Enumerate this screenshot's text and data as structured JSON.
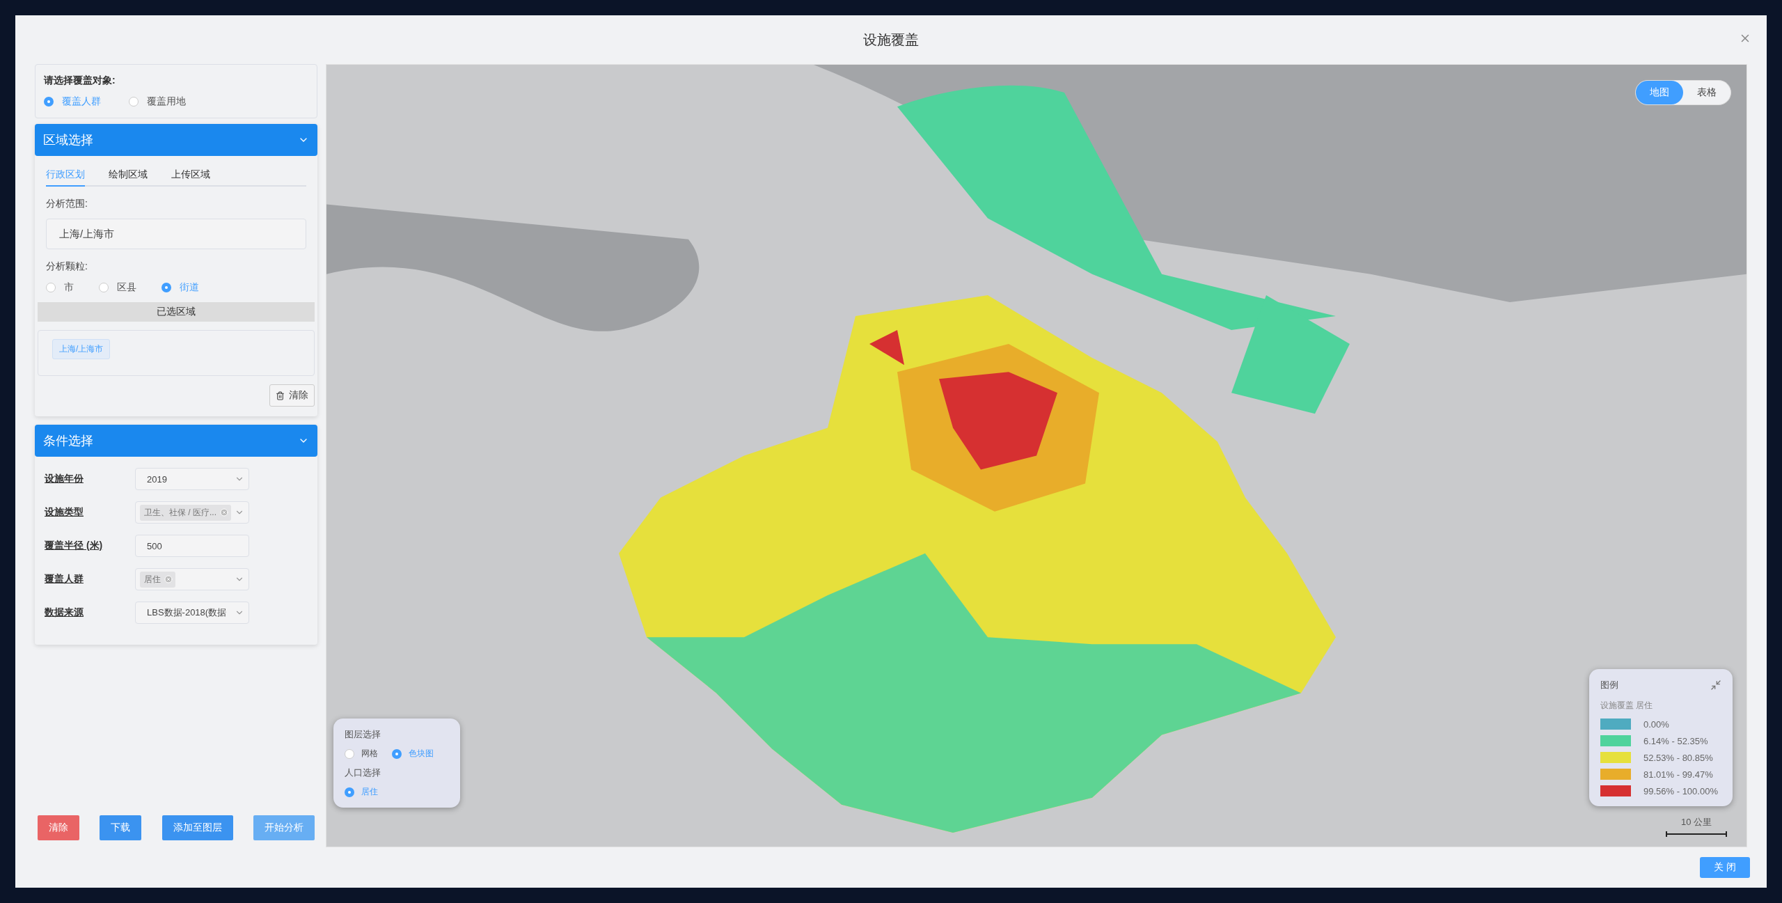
{
  "dialog": {
    "title": "设施覆盖",
    "close_button": "关 闭"
  },
  "target": {
    "label": "请选择覆盖对象:",
    "options": [
      {
        "label": "覆盖人群",
        "selected": true
      },
      {
        "label": "覆盖用地",
        "selected": false
      }
    ]
  },
  "region": {
    "title": "区域选择",
    "expanded": true,
    "tabs": [
      {
        "label": "行政区划",
        "selected": true
      },
      {
        "label": "绘制区域",
        "selected": false
      },
      {
        "label": "上传区域",
        "selected": false
      }
    ],
    "scope_label": "分析范围:",
    "scope_value": "上海/上海市",
    "granularity_label": "分析颗粒:",
    "granularity": [
      {
        "label": "市",
        "selected": false
      },
      {
        "label": "区县",
        "selected": false
      },
      {
        "label": "街道",
        "selected": true
      }
    ],
    "selected_header": "已选区域",
    "selected_tags": [
      "上海/上海市"
    ],
    "clear_button": "清除"
  },
  "conditions": {
    "title": "条件选择",
    "expanded": true,
    "rows": [
      {
        "label": "设施年份",
        "kind": "select",
        "value": "2019"
      },
      {
        "label": "设施类型",
        "kind": "tags",
        "tags": [
          "卫生、社保 / 医疗..."
        ]
      },
      {
        "label": "覆盖半径 (米)",
        "kind": "input",
        "value": "500"
      },
      {
        "label": "覆盖人群",
        "kind": "tags",
        "tags": [
          "居住"
        ]
      },
      {
        "label": "数据来源",
        "kind": "select",
        "value": "LBS数据-2018(数据"
      }
    ]
  },
  "actions": [
    {
      "label": "清除",
      "kind": "danger"
    },
    {
      "label": "下载",
      "kind": "primary"
    },
    {
      "label": "添加至图层",
      "kind": "primary"
    },
    {
      "label": "开始分析",
      "kind": "light"
    }
  ],
  "view_toggle": [
    {
      "label": "地图",
      "selected": true
    },
    {
      "label": "表格",
      "selected": false
    }
  ],
  "layer_panel": {
    "layer_title": "图层选择",
    "layers": [
      {
        "label": "网格",
        "selected": false
      },
      {
        "label": "色块图",
        "selected": true
      }
    ],
    "population_title": "人口选择",
    "populations": [
      {
        "label": "居住",
        "selected": true
      }
    ]
  },
  "legend": {
    "title": "图例",
    "subtitle": "设施覆盖 居住",
    "items": [
      {
        "label": "0.00%",
        "color": "#4fabc0"
      },
      {
        "label": "6.14% - 52.35%",
        "color": "#4fd39c"
      },
      {
        "label": "52.53% - 80.85%",
        "color": "#e6e03c"
      },
      {
        "label": "81.01% - 99.47%",
        "color": "#e8ad2a"
      },
      {
        "label": "99.56% - 100.00%",
        "color": "#d63031"
      }
    ]
  },
  "scale_bar": "10 公里"
}
